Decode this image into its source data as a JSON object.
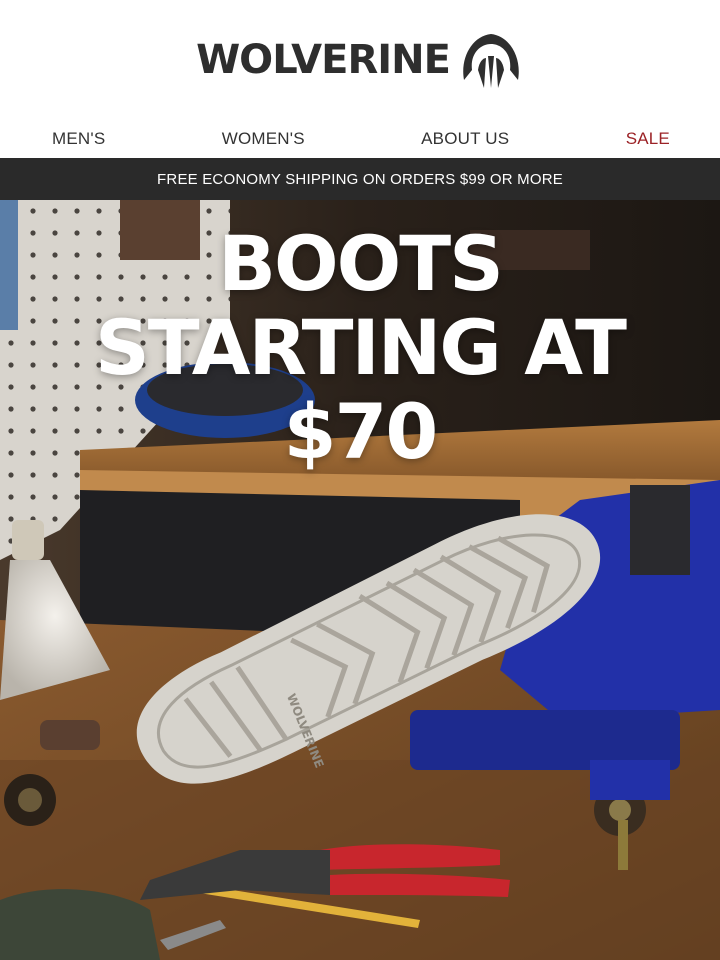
{
  "brand": {
    "name": "WOLVERINE",
    "logo_icon": "wolverine-claw-icon"
  },
  "nav": {
    "items": [
      {
        "label": "MEN'S"
      },
      {
        "label": "WOMEN'S"
      },
      {
        "label": "ABOUT US"
      },
      {
        "label": "SALE",
        "color": "#9b2226"
      }
    ]
  },
  "promo": {
    "text": "FREE ECONOMY SHIPPING ON ORDERS $99 OR MORE"
  },
  "hero": {
    "line1": "BOOTS",
    "line2": "STARTING AT",
    "line3": "$70",
    "sole_brand": "WOLVERINE"
  },
  "colors": {
    "header_bg": "#ffffff",
    "promo_bg": "#2a2a2a",
    "sale": "#9b2226",
    "vise_blue": "#2230a8",
    "plier_red": "#c8262d"
  }
}
